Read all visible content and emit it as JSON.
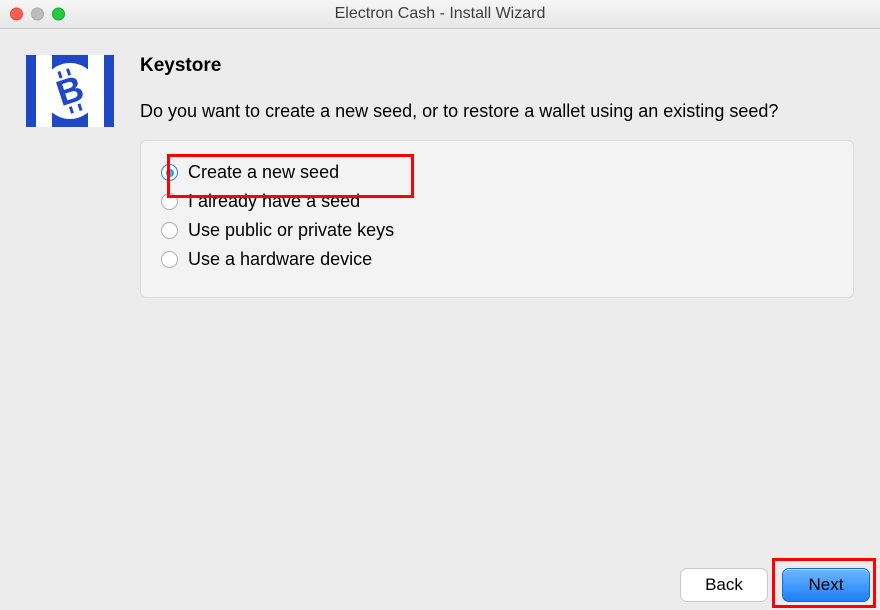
{
  "window": {
    "title": "Electron Cash  -  Install Wizard"
  },
  "heading": "Keystore",
  "question": "Do you want to create a new seed, or to restore a wallet using an existing seed?",
  "options": [
    {
      "label": "Create a new seed",
      "selected": true
    },
    {
      "label": "I already have a seed",
      "selected": false
    },
    {
      "label": "Use public or private keys",
      "selected": false
    },
    {
      "label": "Use a hardware device",
      "selected": false
    }
  ],
  "buttons": {
    "back": "Back",
    "next": "Next"
  }
}
